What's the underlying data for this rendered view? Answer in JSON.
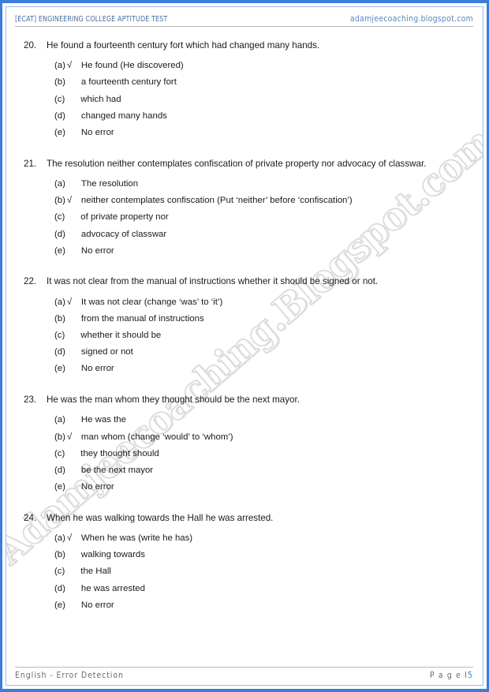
{
  "header": {
    "left_title": "[ECAT] ENGINEERING COLLEGE APTITUDE TEST",
    "site_url": "adamjeecoaching.blogspot.com"
  },
  "watermark": {
    "text": "Adamjeecoaching.Blogspot.com"
  },
  "colors": {
    "page_border": "#3b7dd8",
    "header_text": "#4a6fa5",
    "site_url": "#5b86c4",
    "footer_text": "#6b6b6b",
    "page_number": "#3b7dd8",
    "body_text": "#1a1a1a",
    "watermark": "#dcdcdc"
  },
  "tick_glyph": "√",
  "questions": [
    {
      "number": "20.",
      "text": "He found a fourteenth century fort which had changed many hands.",
      "justified": false,
      "options": [
        {
          "label": "(a)",
          "tick": "√",
          "text": "He found (He discovered)"
        },
        {
          "label": "(b)",
          "tick": "",
          "text": "a fourteenth century fort"
        },
        {
          "label": "(c)",
          "tick": "",
          "text": "which had"
        },
        {
          "label": "(d)",
          "tick": "",
          "text": "changed many hands"
        },
        {
          "label": "(e)",
          "tick": "",
          "text": "No error"
        }
      ]
    },
    {
      "number": "21.",
      "text": "The resolution neither contemplates confiscation of private property nor advocacy of classwar.",
      "justified": true,
      "options": [
        {
          "label": "(a)",
          "tick": "",
          "text": "The resolution"
        },
        {
          "label": "(b)",
          "tick": "√",
          "text": "neither contemplates confiscation (Put ‘neither’ before ‘confiscation’)"
        },
        {
          "label": "(c)",
          "tick": "",
          "text": "of private property nor"
        },
        {
          "label": "(d)",
          "tick": "",
          "text": "advocacy of classwar"
        },
        {
          "label": "(e)",
          "tick": "",
          "text": "No error"
        }
      ]
    },
    {
      "number": "22.",
      "text": "It was not clear from the manual of instructions whether it should be signed or not.",
      "justified": false,
      "options": [
        {
          "label": "(a)",
          "tick": "√",
          "text": "It was not clear (change ‘was’ to ‘it’)"
        },
        {
          "label": "(b)",
          "tick": "",
          "text": "from the manual of instructions"
        },
        {
          "label": "(c)",
          "tick": "",
          "text": "whether it should be"
        },
        {
          "label": "(d)",
          "tick": "",
          "text": "signed or not"
        },
        {
          "label": "(e)",
          "tick": "",
          "text": "No error"
        }
      ]
    },
    {
      "number": "23.",
      "text": "He was the man whom they thought should be the next mayor.",
      "justified": false,
      "options": [
        {
          "label": "(a)",
          "tick": "",
          "text": "He was the"
        },
        {
          "label": "(b)",
          "tick": "√",
          "text": "man whom (change ‘would’ to ‘whom’)"
        },
        {
          "label": "(c)",
          "tick": "",
          "text": "they thought should"
        },
        {
          "label": "(d)",
          "tick": "",
          "text": "be the next mayor"
        },
        {
          "label": "(e)",
          "tick": "",
          "text": "No error"
        }
      ]
    },
    {
      "number": "24.",
      "text": "When he was walking towards the Hall he was arrested.",
      "justified": false,
      "options": [
        {
          "label": "(a)",
          "tick": "√",
          "text": "When he was (write he has)"
        },
        {
          "label": "(b)",
          "tick": "",
          "text": "walking towards"
        },
        {
          "label": "(c)",
          "tick": "",
          "text": "the Hall"
        },
        {
          "label": "(d)",
          "tick": "",
          "text": "he was arrested"
        },
        {
          "label": "(e)",
          "tick": "",
          "text": "No error"
        }
      ]
    }
  ],
  "footer": {
    "subject": "English - Error Detection",
    "page_label": "P a g e  I",
    "page_number": "5"
  }
}
